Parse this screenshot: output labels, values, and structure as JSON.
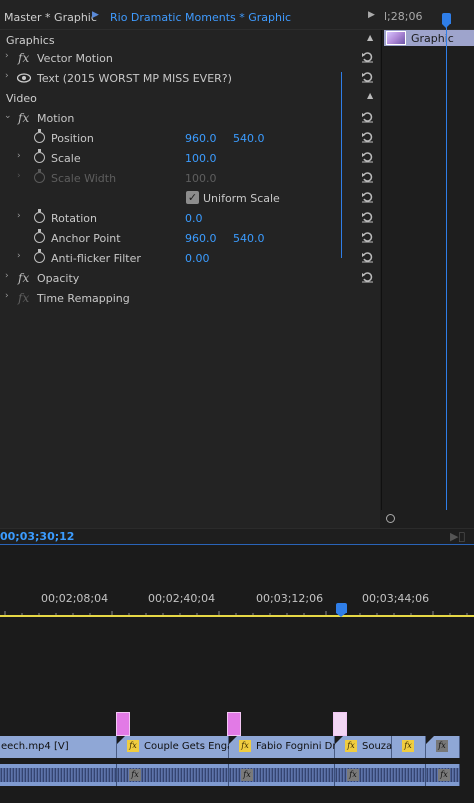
{
  "tabs": {
    "master": "Master * Graphic",
    "sequence": "Rio Dramatic Moments * Graphic"
  },
  "top_timecode": "l;28;06",
  "graphic_clip_label": "Graphic",
  "sections": {
    "graphics": "Graphics",
    "video": "Video"
  },
  "effects": {
    "vector_motion": "Vector Motion",
    "text_layer": "Text (2015 WORST MP MISS EVER?)",
    "motion": "Motion",
    "opacity": "Opacity",
    "time_remapping": "Time Remapping"
  },
  "properties": {
    "position": {
      "label": "Position",
      "x": "960.0",
      "y": "540.0"
    },
    "scale": {
      "label": "Scale",
      "value": "100.0"
    },
    "scale_width": {
      "label": "Scale Width",
      "value": "100.0"
    },
    "uniform_scale": {
      "label": "Uniform Scale",
      "checked": true
    },
    "rotation": {
      "label": "Rotation",
      "value": "0.0"
    },
    "anchor_point": {
      "label": "Anchor Point",
      "x": "960.0",
      "y": "540.0"
    },
    "anti_flicker": {
      "label": "Anti-flicker Filter",
      "value": "0.00"
    }
  },
  "footer_timecode": "00;03;30;12",
  "ruler_labels": [
    "00;02;08;04",
    "00;02;40;04",
    "00;03;12;06",
    "00;03;44;06"
  ],
  "video_clips": [
    "eech.mp4 [V]",
    "Couple Gets Engaged",
    "Fabio Fognini Drop",
    "Souza",
    "",
    ""
  ],
  "colors": {
    "accent_blue": "#3b9cff",
    "clip_blue": "#8fa7d6",
    "graphic_pink": "#e27ae6",
    "work_area_yellow": "#e6d846",
    "fx_yellow": "#f0cd40"
  }
}
